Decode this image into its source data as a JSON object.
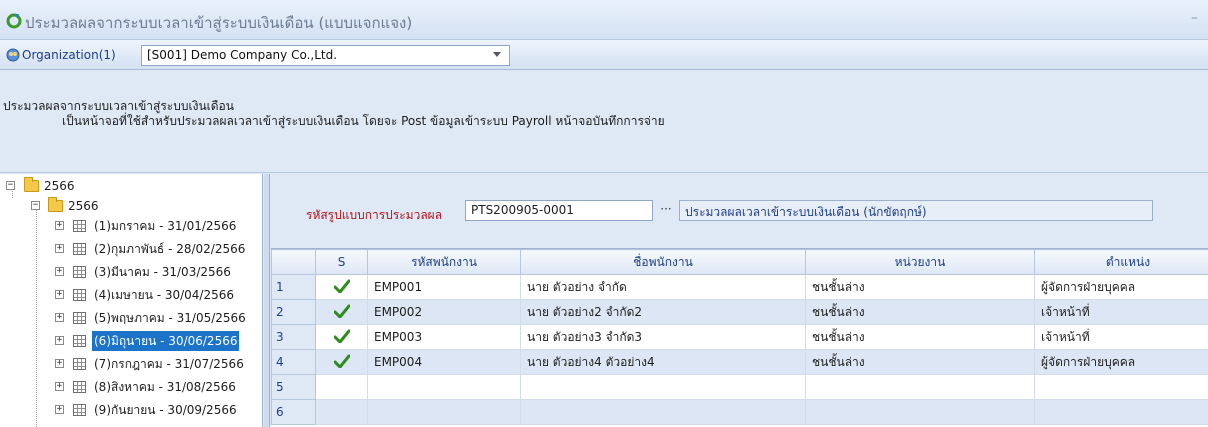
{
  "window": {
    "title": "ประมวลผลจากระบบเวลาเข้าสู่ระบบเงินเดือน (แบบแจกแจง)",
    "minimize": "–"
  },
  "org": {
    "label": "Organization(1)",
    "selected": "[S001] Demo Company Co.,Ltd."
  },
  "description": {
    "line1": "ประมวลผลจากระบบเวลาเข้าสู่ระบบเงินเดือน",
    "line2": "เป็นหน้าจอที่ใช้สำหรับประมวลผลเวลาเข้าสู่ระบบเงินเดือน โดยจะ Post ข้อมูลเข้าระบบ Payroll หน้าจอบันทึกการจ่าย"
  },
  "tree": {
    "root": "2566",
    "child": "2566",
    "periods": [
      "(1)มกราคม - 31/01/2566",
      "(2)กุมภาพันธ์ - 28/02/2566",
      "(3)มีนาคม - 31/03/2566",
      "(4)เมษายน - 30/04/2566",
      "(5)พฤษภาคม - 31/05/2566",
      "(6)มิถุนายน - 30/06/2566",
      "(7)กรกฎาคม - 31/07/2566",
      "(8)สิงหาคม - 31/08/2566",
      "(9)กันยายน - 30/09/2566"
    ],
    "selected_index": 5
  },
  "form": {
    "label": "รหัสรูปแบบการประมวลผล",
    "code": "PTS200905-0001",
    "dots": "···",
    "name": "ประมวลผลเวลาเข้าระบบเงินเดือน (นักขัตฤกษ์)"
  },
  "grid": {
    "columns": [
      "S",
      "รหัสพนักงาน",
      "ชื่อพนักงาน",
      "หน่วยงาน",
      "ตำแหน่ง"
    ],
    "rows": [
      {
        "n": "1",
        "checked": true,
        "code": "EMP001",
        "name": "นาย ตัวอย่าง จำกัด",
        "dept": "ชนชั้นล่าง",
        "pos": "ผู้จัดการฝ่ายบุคคล"
      },
      {
        "n": "2",
        "checked": true,
        "code": "EMP002",
        "name": "นาย ตัวอย่าง2 จำกัด2",
        "dept": "ชนชั้นล่าง",
        "pos": "เจ้าหน้าที่"
      },
      {
        "n": "3",
        "checked": true,
        "code": "EMP003",
        "name": "นาย ตัวอย่าง3 จำกัด3",
        "dept": "ชนชั้นล่าง",
        "pos": "เจ้าหน้าที่"
      },
      {
        "n": "4",
        "checked": true,
        "code": "EMP004",
        "name": "นาย ตัวอย่าง4 ตัวอย่าง4",
        "dept": "ชนชั้นล่าง",
        "pos": "ผู้จัดการฝ่ายบุคคล"
      },
      {
        "n": "5",
        "checked": false,
        "code": "",
        "name": "",
        "dept": "",
        "pos": ""
      },
      {
        "n": "6",
        "checked": false,
        "code": "",
        "name": "",
        "dept": "",
        "pos": ""
      }
    ]
  },
  "colors": {
    "accent": "#1c74c9",
    "label_red": "#b0161a",
    "check_green": "#2e8b1e",
    "header_text": "#1e3f86"
  }
}
